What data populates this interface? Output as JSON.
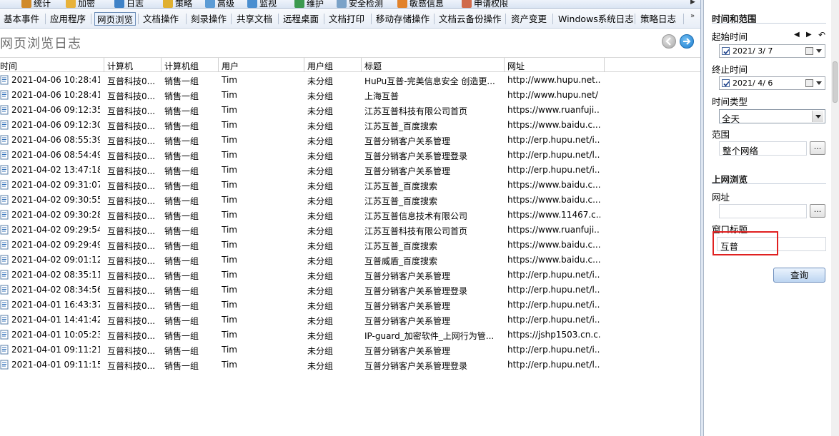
{
  "top_toolbar": {
    "items": [
      {
        "label": "统计",
        "color": "#d08a2a"
      },
      {
        "label": "加密",
        "color": "#e8b23a"
      },
      {
        "label": "日志",
        "color": "#3f82c7"
      },
      {
        "label": "策略",
        "color": "#e0b030"
      },
      {
        "label": "高级",
        "color": "#5b9bd5"
      },
      {
        "label": "监视",
        "color": "#4a8ed0"
      },
      {
        "label": "维护",
        "color": "#3c9a4f"
      },
      {
        "label": "安全检测",
        "color": "#7aa2c8"
      },
      {
        "label": "敏感信息",
        "color": "#e2822a"
      },
      {
        "label": "申请权限",
        "color": "#d06a4a"
      }
    ]
  },
  "log_tabs": {
    "items": [
      "基本事件",
      "应用程序",
      "网页浏览",
      "文档操作",
      "刻录操作",
      "共享文档",
      "远程桌面",
      "文档打印",
      "移动存储操作",
      "文档云备份操作",
      "资产变更",
      "Windows系统日志",
      "策略日志"
    ],
    "active_index": 2,
    "more": "»"
  },
  "page": {
    "title": "网页浏览日志"
  },
  "grid": {
    "columns": [
      "时间",
      "计算机",
      "计算机组",
      "用户",
      "用户组",
      "标题",
      "网址"
    ],
    "rows": [
      [
        "2021-04-06 10:28:41",
        "互普科技0...",
        "销售一组",
        "Tim",
        "未分组",
        "HuPu互普-完美信息安全 创造更...",
        "http://www.hupu.net..."
      ],
      [
        "2021-04-06 10:28:41",
        "互普科技0...",
        "销售一组",
        "Tim",
        "未分组",
        "上海互普",
        "http://www.hupu.net/"
      ],
      [
        "2021-04-06 09:12:35",
        "互普科技0...",
        "销售一组",
        "Tim",
        "未分组",
        "江苏互普科技有限公司首页",
        "https://www.ruanfuji..."
      ],
      [
        "2021-04-06 09:12:30",
        "互普科技0...",
        "销售一组",
        "Tim",
        "未分组",
        "江苏互普_百度搜索",
        "https://www.baidu.c..."
      ],
      [
        "2021-04-06 08:55:39",
        "互普科技0...",
        "销售一组",
        "Tim",
        "未分组",
        "互普分销客户关系管理",
        "http://erp.hupu.net/i..."
      ],
      [
        "2021-04-06 08:54:49",
        "互普科技0...",
        "销售一组",
        "Tim",
        "未分组",
        "互普分销客户关系管理登录",
        "http://erp.hupu.net/l..."
      ],
      [
        "2021-04-02 13:47:18",
        "互普科技0...",
        "销售一组",
        "Tim",
        "未分组",
        "互普分销客户关系管理",
        "http://erp.hupu.net/i..."
      ],
      [
        "2021-04-02 09:31:07",
        "互普科技0...",
        "销售一组",
        "Tim",
        "未分组",
        "江苏互普_百度搜索",
        "https://www.baidu.c..."
      ],
      [
        "2021-04-02 09:30:55",
        "互普科技0...",
        "销售一组",
        "Tim",
        "未分组",
        "江苏互普_百度搜索",
        "https://www.baidu.c..."
      ],
      [
        "2021-04-02 09:30:28",
        "互普科技0...",
        "销售一组",
        "Tim",
        "未分组",
        "江苏互普信息技术有限公司",
        "https://www.11467.c..."
      ],
      [
        "2021-04-02 09:29:54",
        "互普科技0...",
        "销售一组",
        "Tim",
        "未分组",
        "江苏互普科技有限公司首页",
        "https://www.ruanfuji..."
      ],
      [
        "2021-04-02 09:29:49",
        "互普科技0...",
        "销售一组",
        "Tim",
        "未分组",
        "江苏互普_百度搜索",
        "https://www.baidu.c..."
      ],
      [
        "2021-04-02 09:01:12",
        "互普科技0...",
        "销售一组",
        "Tim",
        "未分组",
        "互普威盾_百度搜索",
        "https://www.baidu.c..."
      ],
      [
        "2021-04-02 08:35:11",
        "互普科技0...",
        "销售一组",
        "Tim",
        "未分组",
        "互普分销客户关系管理",
        "http://erp.hupu.net/i..."
      ],
      [
        "2021-04-02 08:34:56",
        "互普科技0...",
        "销售一组",
        "Tim",
        "未分组",
        "互普分销客户关系管理登录",
        "http://erp.hupu.net/l..."
      ],
      [
        "2021-04-01 16:43:37",
        "互普科技0...",
        "销售一组",
        "Tim",
        "未分组",
        "互普分销客户关系管理",
        "http://erp.hupu.net/i..."
      ],
      [
        "2021-04-01 14:41:42",
        "互普科技0...",
        "销售一组",
        "Tim",
        "未分组",
        "互普分销客户关系管理",
        "http://erp.hupu.net/i..."
      ],
      [
        "2021-04-01 10:05:23",
        "互普科技0...",
        "销售一组",
        "Tim",
        "未分组",
        "IP-guard_加密软件_上网行为管...",
        "https://jshp1503.cn.c..."
      ],
      [
        "2021-04-01 09:11:21",
        "互普科技0...",
        "销售一组",
        "Tim",
        "未分组",
        "互普分销客户关系管理",
        "http://erp.hupu.net/i..."
      ],
      [
        "2021-04-01 09:11:15",
        "互普科技0...",
        "销售一组",
        "Tim",
        "未分组",
        "互普分销客户关系管理登录",
        "http://erp.hupu.net/l..."
      ]
    ]
  },
  "panel": {
    "time_section_title": "时间和范围",
    "start_label": "起始时间",
    "start_value": "2021/  3/  7",
    "start_checked": true,
    "end_label": "终止时间",
    "end_value": "2021/  4/  6",
    "end_checked": true,
    "time_type_label": "时间类型",
    "time_type_value": "全天",
    "range_label": "范围",
    "range_value": "整个网络",
    "browse_section_title": "上网浏览",
    "url_label": "网址",
    "url_value": "",
    "window_title_label": "窗口标题",
    "window_title_value": "互普",
    "query_button": "查询",
    "dots_label": "...",
    "highlight_color": "#e02020"
  },
  "colors": {
    "accent": "#1f7fd0",
    "tab_active_border": "#6f8fb8"
  }
}
